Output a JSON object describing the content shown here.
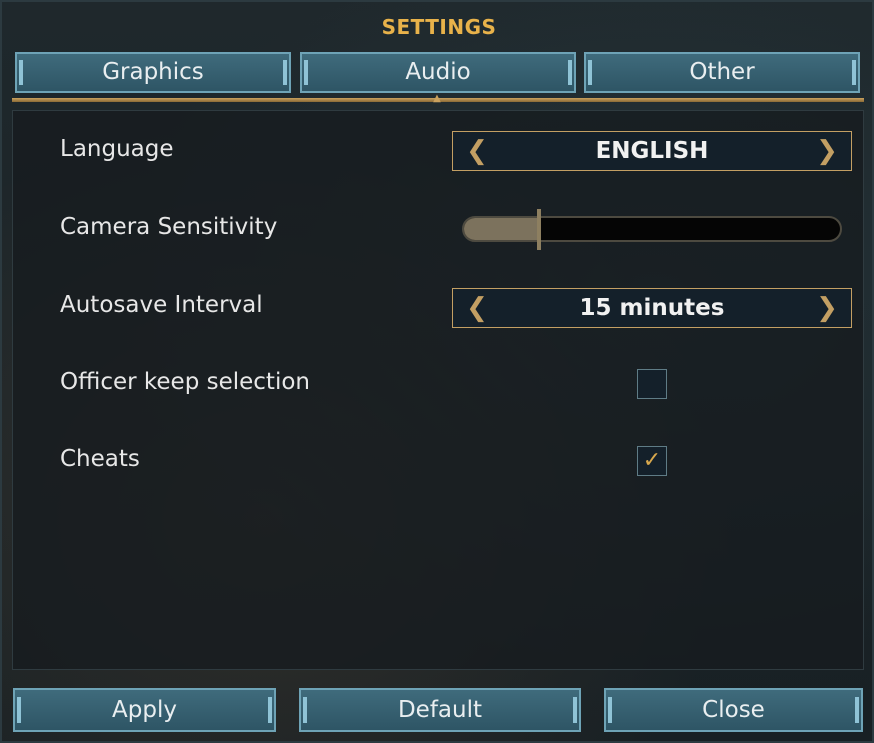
{
  "window": {
    "title": "SETTINGS"
  },
  "tabs": [
    {
      "label": "Graphics"
    },
    {
      "label": "Audio"
    },
    {
      "label": "Other"
    }
  ],
  "settings": {
    "language": {
      "label": "Language",
      "value": "ENGLISH"
    },
    "camera_sensitivity": {
      "label": "Camera Sensitivity",
      "value_fraction": 0.2
    },
    "autosave_interval": {
      "label": "Autosave Interval",
      "value": "15 minutes"
    },
    "officer_keep_selection": {
      "label": "Officer keep selection",
      "checked": false
    },
    "cheats": {
      "label": "Cheats",
      "checked": true,
      "check_glyph": "✓"
    }
  },
  "icons": {
    "arrow_left": "❮",
    "arrow_right": "❯"
  },
  "buttons": {
    "apply": "Apply",
    "default": "Default",
    "close": "Close"
  },
  "colors": {
    "accent_gold": "#e8b24a",
    "button_blue": "#3f6b7c",
    "check_mark": "#d8a84d"
  }
}
